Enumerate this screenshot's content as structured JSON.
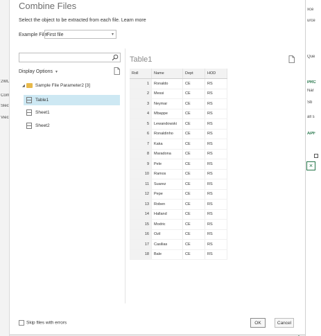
{
  "background": {
    "left_fragments": [
      "2WL",
      "Comp",
      "Slecti",
      "Vieci"
    ],
    "right_fragments": [
      "xce",
      "urce",
      "Que",
      "Nar",
      "Sb",
      "PRC",
      "all s",
      "APF"
    ],
    "right_close": "×"
  },
  "dialog": {
    "title": "Combine Files",
    "subtitle": "Select the object to be extracted from each file. Learn more",
    "example_file_label": "Example File:",
    "example_file_value": "First file",
    "search": {
      "value": "",
      "placeholder": ""
    },
    "display_options": "Display Options",
    "tree": {
      "folder": "Sample File Parameter2 [3]",
      "items": [
        "Table1",
        "Sheet1",
        "Sheet2"
      ],
      "selected": "Table1"
    },
    "preview": {
      "title": "Table1",
      "columns": [
        "Roll",
        "Name",
        "Dept",
        "HOD"
      ],
      "rows": [
        [
          "1",
          "Ronaldo",
          "CE",
          "RS"
        ],
        [
          "2",
          "Messi",
          "CE",
          "RS"
        ],
        [
          "3",
          "Neymar",
          "CE",
          "RS"
        ],
        [
          "4",
          "Mbappe",
          "CE",
          "RS"
        ],
        [
          "5",
          "Lewandowski",
          "CE",
          "RS"
        ],
        [
          "6",
          "Ronaldinho",
          "CE",
          "RS"
        ],
        [
          "7",
          "Kaka",
          "CE",
          "RS"
        ],
        [
          "8",
          "Maradona",
          "CE",
          "RS"
        ],
        [
          "9",
          "Pele",
          "CE",
          "RS"
        ],
        [
          "10",
          "Ramos",
          "CE",
          "RS"
        ],
        [
          "11",
          "Suarez",
          "CE",
          "RS"
        ],
        [
          "12",
          "Pepe",
          "CE",
          "RS"
        ],
        [
          "13",
          "Roben",
          "CE",
          "RS"
        ],
        [
          "14",
          "Halland",
          "CE",
          "RS"
        ],
        [
          "15",
          "Modric",
          "CE",
          "RS"
        ],
        [
          "16",
          "Ozil",
          "CE",
          "RS"
        ],
        [
          "17",
          "Casilias",
          "CE",
          "RS"
        ],
        [
          "18",
          "Bale",
          "CE",
          "RS"
        ]
      ]
    },
    "skip_label": "Skip files with errors",
    "skip_checked": false,
    "ok_label": "OK",
    "cancel_label": "Cancel"
  }
}
